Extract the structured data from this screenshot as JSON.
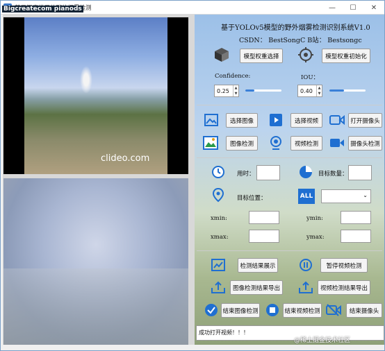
{
  "window": {
    "title": "基于深度学习的野外烟雾检测系统",
    "overlay_text": "Bigcreatecom pianods"
  },
  "header": {
    "title": "基于YOLOv5模型的野外烟雾检测识别系统V1.0",
    "csdn_line": "CSDN： BestSongC  B站： Bestsongc"
  },
  "model": {
    "select_label": "模型权重选择",
    "init_label": "模型权重初始化",
    "icon_select": "cube-icon",
    "icon_init": "target-icon"
  },
  "params": {
    "confidence_label": "Confidence:",
    "confidence_value": "0.25",
    "iou_label": "IOU：",
    "iou_value": "0.40",
    "confidence_fraction": 0.25,
    "iou_fraction": 0.4
  },
  "media": {
    "select_image": "选择图像",
    "select_video": "选择视频",
    "open_camera": "打开摄像头",
    "detect_image": "图像检测",
    "detect_video": "视频检测",
    "detect_camera": "摄像头检测"
  },
  "results": {
    "time_label": "用时：",
    "count_label": "目标数量：",
    "position_label": "目标位置：",
    "select_value": "",
    "xmin": "xmin:",
    "ymin": "ymin:",
    "xmax": "xmax:",
    "ymax": "ymax:"
  },
  "actions": {
    "show_results": "检测结果展示",
    "pause_video": "暂停视频检测",
    "export_image": "图像检测结果导出",
    "export_video": "视频检测结果导出",
    "end_image": "结束图像检测",
    "end_video": "结束视频检测",
    "end_camera": "结束摄像头"
  },
  "status": {
    "text": "成功打开视频！！！"
  },
  "video": {
    "watermark": "clideo.com"
  },
  "footer": {
    "watermark": "@稀土掘金技术社区"
  },
  "colors": {
    "accent": "#1f6fd1",
    "panel_bg": "#f0f0f0"
  }
}
